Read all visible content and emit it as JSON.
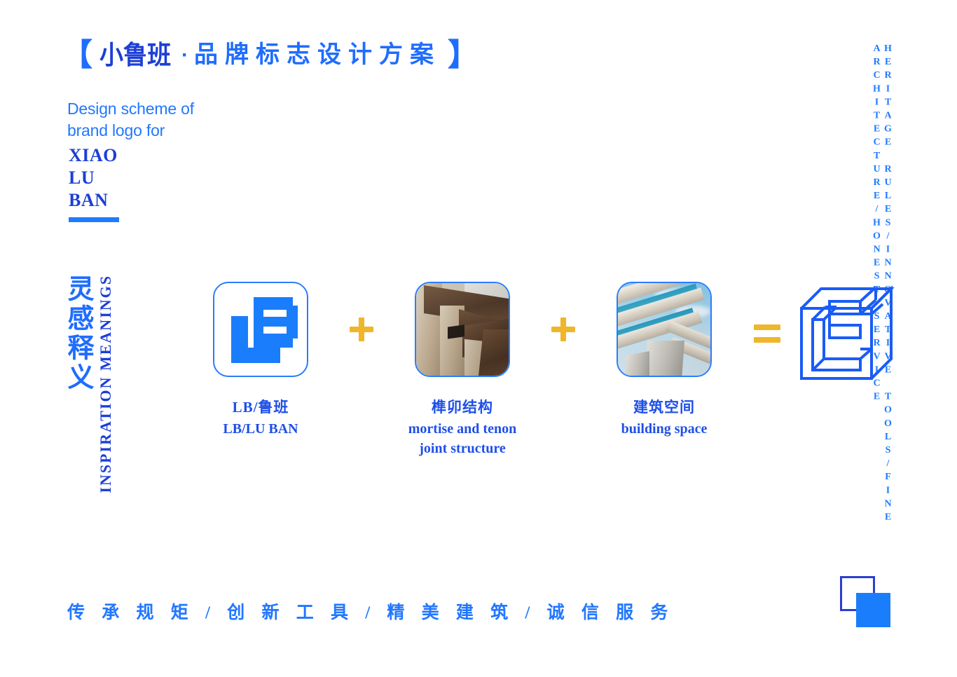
{
  "page": {
    "background": "#ffffff",
    "accent_blue": "#1f7bff",
    "deep_blue": "#1d3fd6",
    "gold": "#efb62a"
  },
  "header": {
    "bracket_left": "【",
    "bracket_right": "】",
    "brand_cn": "小鲁班",
    "separator_dot": "·",
    "title_rest_cn": "品牌标志设计方案",
    "subtitle_line1": "Design scheme of",
    "subtitle_line2": "brand logo for",
    "brand_en_line1": "XIAO",
    "brand_en_line2": "LU",
    "brand_en_line3": "BAN"
  },
  "side_label": {
    "cn": "灵感释义",
    "en": "INSPIRATION MEANINGS"
  },
  "right_label": {
    "text": "HERITAGE RULES/INNOVATIVE TOOLS/FINE ARCHITECTURE/HONEST SERVICE"
  },
  "formula": {
    "operators": {
      "plus_1": "+",
      "plus_2": "+",
      "equals": "="
    },
    "items": [
      {
        "icon": "lb-monogram-logo",
        "caption_cn": "LB/鲁班",
        "caption_en": "LB/LU BAN",
        "caption_en2": ""
      },
      {
        "icon": "mortise-tenon-photo",
        "caption_cn": "榫卯结构",
        "caption_en": "mortise and tenon",
        "caption_en2": "joint structure"
      },
      {
        "icon": "building-space-photo",
        "caption_cn": "建筑空间",
        "caption_en": "building space",
        "caption_en2": ""
      }
    ],
    "result": {
      "icon": "isometric-cube-logo",
      "caption_cn": "",
      "caption_en": ""
    }
  },
  "footer": {
    "slogan": "传 承 规 矩 / 创 新 工 具 / 精 美 建 筑 / 诚 信 服 务"
  }
}
